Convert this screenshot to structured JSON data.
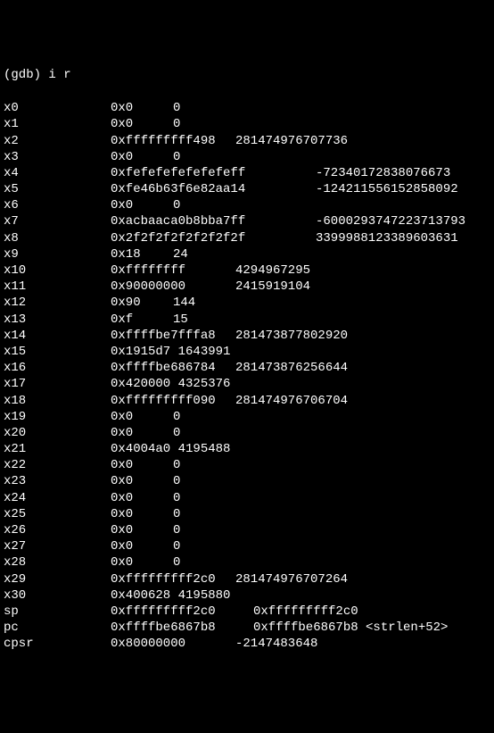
{
  "prompt": "(gdb) i r",
  "registers": [
    {
      "name": "x0",
      "hex": "0x0",
      "dec": "0",
      "hw": "w1"
    },
    {
      "name": "x1",
      "hex": "0x0",
      "dec": "0",
      "hw": "w1"
    },
    {
      "name": "x2",
      "hex": "0xfffffffff498",
      "dec": "281474976707736",
      "hw": "w2"
    },
    {
      "name": "x3",
      "hex": "0x0",
      "dec": "0",
      "hw": "w1"
    },
    {
      "name": "x4",
      "hex": "0xfefefefefefefeff",
      "dec": "-72340172838076673",
      "hw": "w3"
    },
    {
      "name": "x5",
      "hex": "0xfe46b63f6e82aa14",
      "dec": "-124211556152858092",
      "hw": "w3"
    },
    {
      "name": "x6",
      "hex": "0x0",
      "dec": "0",
      "hw": "w1"
    },
    {
      "name": "x7",
      "hex": "0xacbaaca0b8bba7ff",
      "dec": "-6000293747223713793",
      "hw": "w3"
    },
    {
      "name": "x8",
      "hex": "0x2f2f2f2f2f2f2f2f",
      "dec": "3399988123389603631",
      "hw": "w3"
    },
    {
      "name": "x9",
      "hex": "0x18",
      "dec": "24",
      "hw": "w1"
    },
    {
      "name": "x10",
      "hex": "0xffffffff",
      "dec": "4294967295",
      "hw": "w2"
    },
    {
      "name": "x11",
      "hex": "0x90000000",
      "dec": "2415919104",
      "hw": "w2"
    },
    {
      "name": "x12",
      "hex": "0x90",
      "dec": "144",
      "hw": "w1"
    },
    {
      "name": "x13",
      "hex": "0xf",
      "dec": "15",
      "hw": "w1"
    },
    {
      "name": "x14",
      "hex": "0xffffbe7fffa8",
      "dec": "281473877802920",
      "hw": "w2"
    },
    {
      "name": "x15",
      "hex": "0x1915d7",
      "dec": "1643991",
      "hw": "w1",
      "tight": true
    },
    {
      "name": "x16",
      "hex": "0xffffbe686784",
      "dec": "281473876256644",
      "hw": "w2"
    },
    {
      "name": "x17",
      "hex": "0x420000",
      "dec": "4325376",
      "hw": "w1",
      "tight": true
    },
    {
      "name": "x18",
      "hex": "0xfffffffff090",
      "dec": "281474976706704",
      "hw": "w2"
    },
    {
      "name": "x19",
      "hex": "0x0",
      "dec": "0",
      "hw": "w1"
    },
    {
      "name": "x20",
      "hex": "0x0",
      "dec": "0",
      "hw": "w1"
    },
    {
      "name": "x21",
      "hex": "0x4004a0",
      "dec": "4195488",
      "hw": "w1",
      "tight": true
    },
    {
      "name": "x22",
      "hex": "0x0",
      "dec": "0",
      "hw": "w1"
    },
    {
      "name": "x23",
      "hex": "0x0",
      "dec": "0",
      "hw": "w1"
    },
    {
      "name": "x24",
      "hex": "0x0",
      "dec": "0",
      "hw": "w1"
    },
    {
      "name": "x25",
      "hex": "0x0",
      "dec": "0",
      "hw": "w1"
    },
    {
      "name": "x26",
      "hex": "0x0",
      "dec": "0",
      "hw": "w1"
    },
    {
      "name": "x27",
      "hex": "0x0",
      "dec": "0",
      "hw": "w1"
    },
    {
      "name": "x28",
      "hex": "0x0",
      "dec": "0",
      "hw": "w1"
    },
    {
      "name": "x29",
      "hex": "0xfffffffff2c0",
      "dec": "281474976707264",
      "hw": "w2"
    },
    {
      "name": "x30",
      "hex": "0x400628",
      "dec": "4195880",
      "hw": "w1",
      "tight": true
    },
    {
      "name": "sp",
      "hex": "0xfffffffff2c0",
      "dec": "0xfffffffff2c0",
      "hw": "w6"
    },
    {
      "name": "pc",
      "hex": "0xffffbe6867b8",
      "dec": "0xffffbe6867b8 <strlen+52>",
      "hw": "w6"
    },
    {
      "name": "cpsr",
      "hex": "0x80000000",
      "dec": "-2147483648",
      "hw": "w2"
    }
  ]
}
